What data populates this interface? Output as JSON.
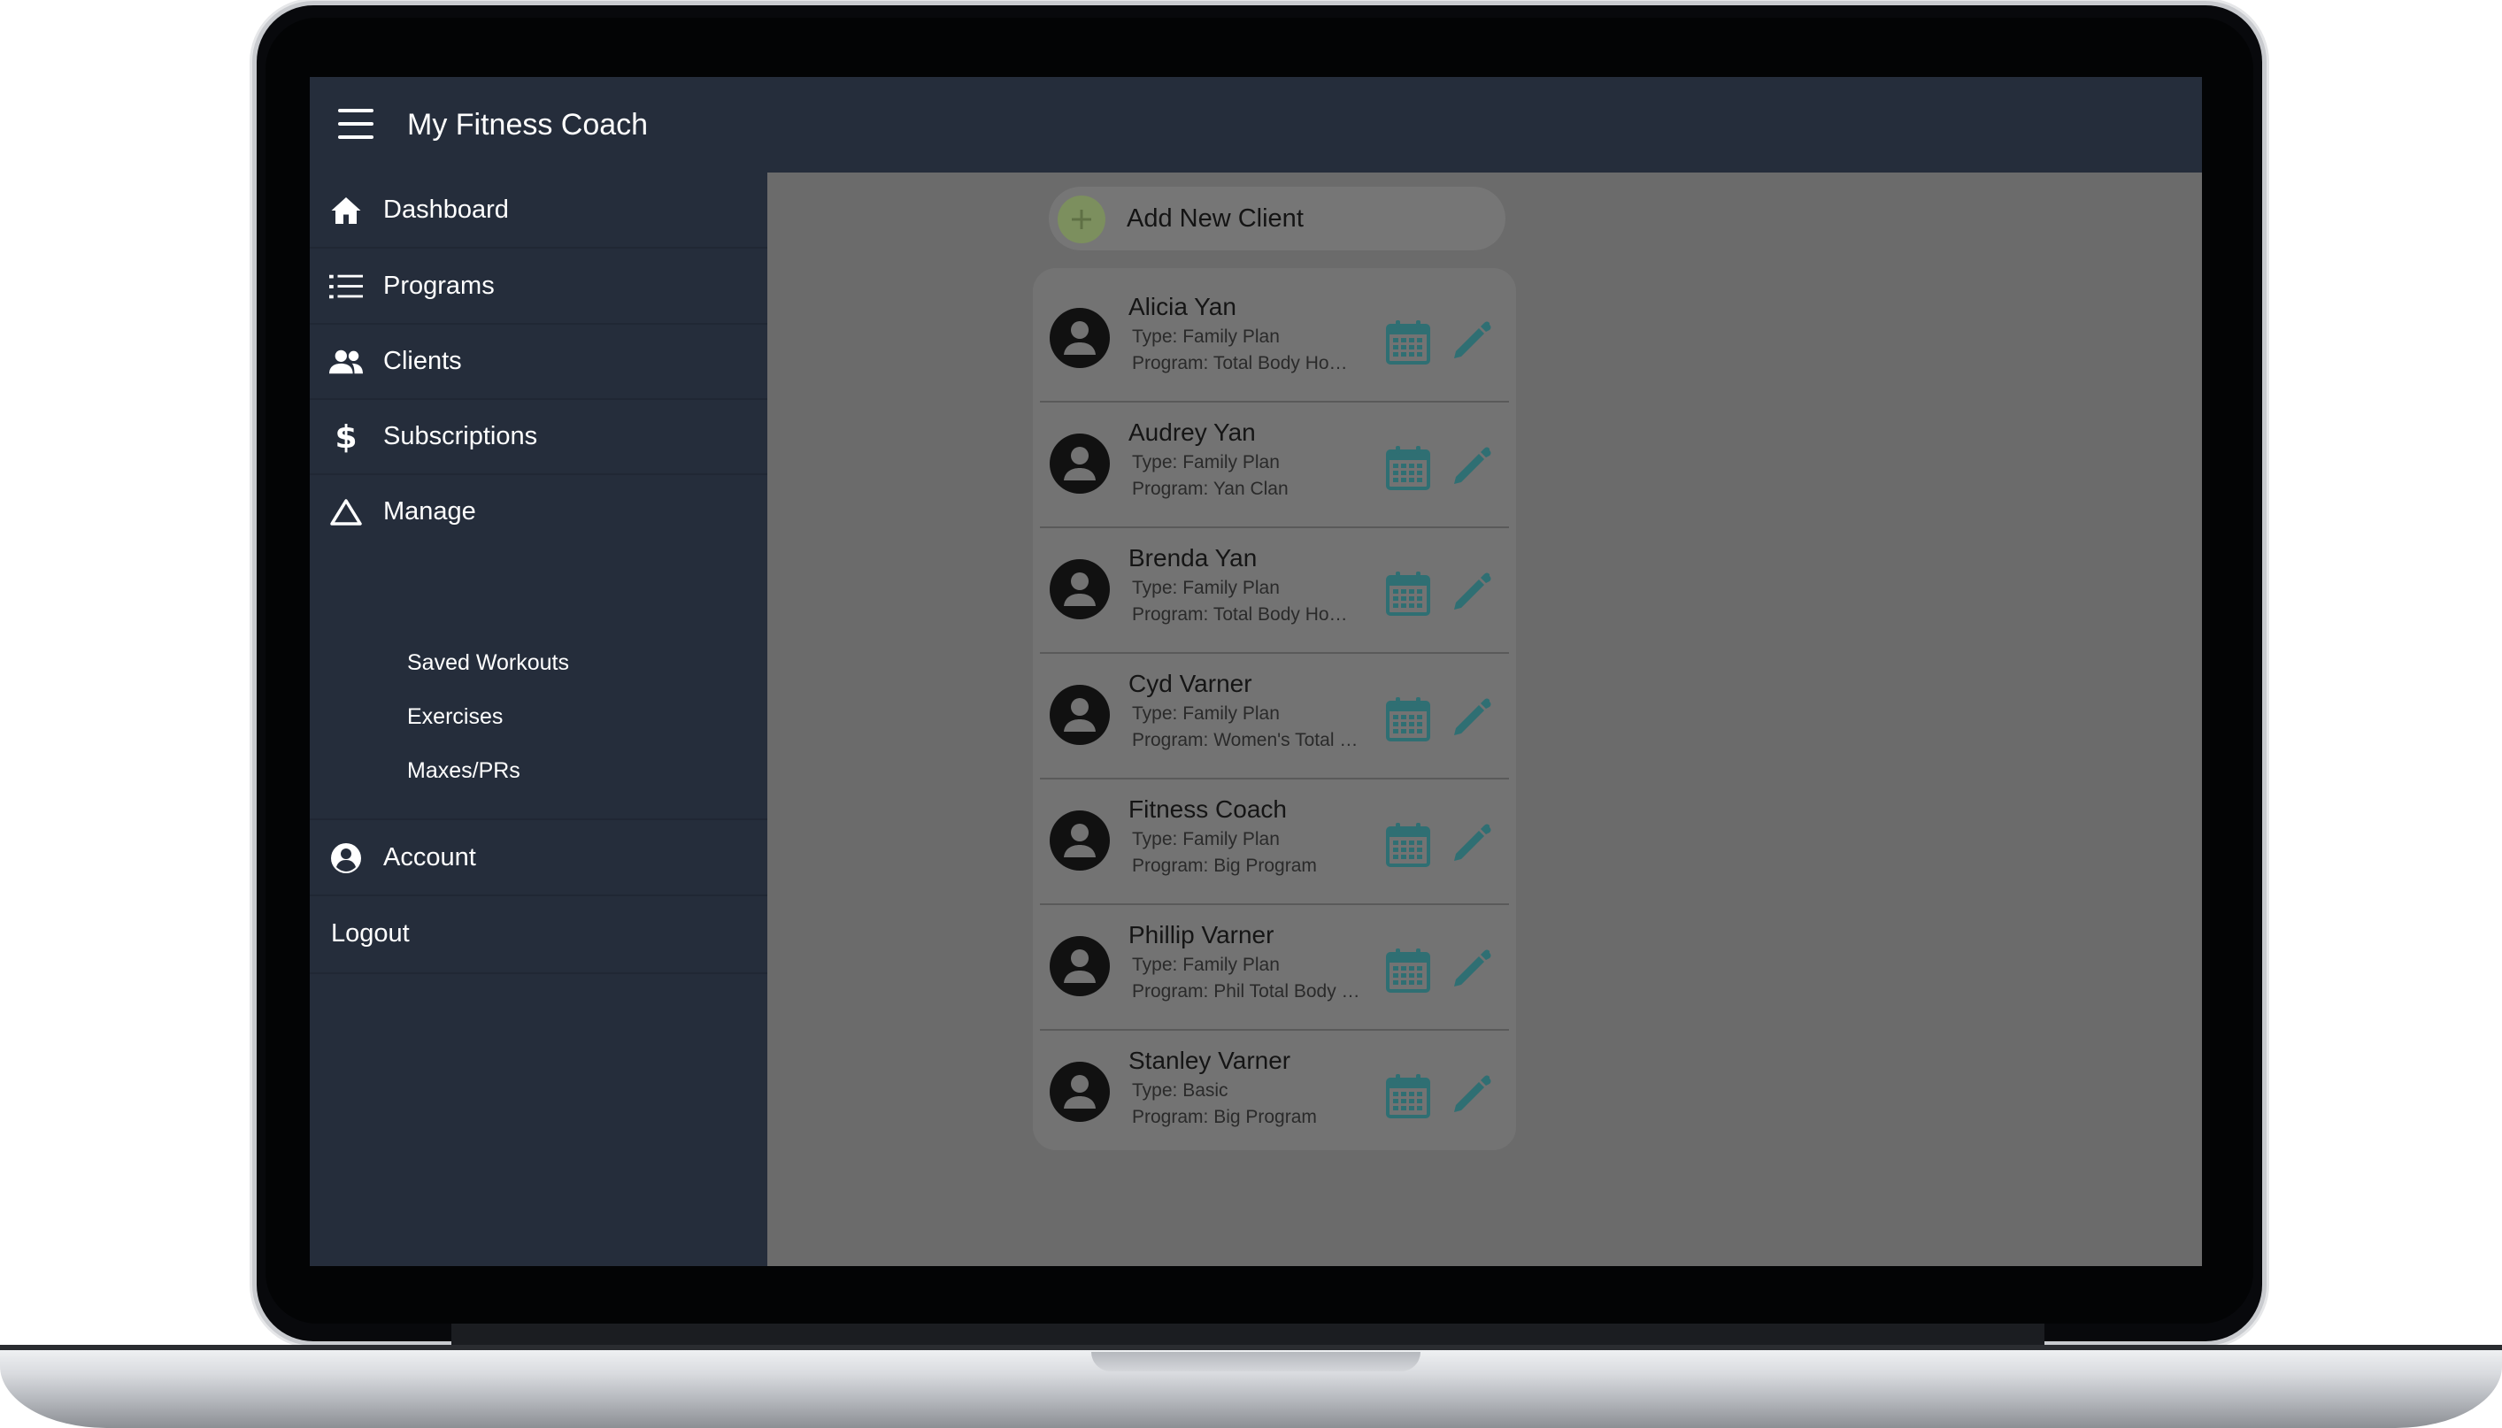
{
  "app": {
    "title": "My Fitness Coach"
  },
  "sidebar": {
    "items": [
      {
        "label": "Dashboard",
        "icon": "home-icon"
      },
      {
        "label": "Programs",
        "icon": "list-icon"
      },
      {
        "label": "Clients",
        "icon": "people-icon"
      },
      {
        "label": "Subscriptions",
        "icon": "dollar-icon"
      },
      {
        "label": "Manage",
        "icon": "triangle-icon"
      }
    ],
    "manage_subitems": [
      "Saved Workouts",
      "Exercises",
      "Maxes/PRs"
    ],
    "account": {
      "label": "Account",
      "icon": "account-circle-icon"
    },
    "logout": "Logout"
  },
  "main": {
    "add_client_label": "Add New Client",
    "clients": [
      {
        "name": "Alicia Yan",
        "type": "Type: Family Plan",
        "program": "Program: Total Body Ho…"
      },
      {
        "name": "Audrey Yan",
        "type": "Type: Family Plan",
        "program": "Program: Yan Clan"
      },
      {
        "name": "Brenda Yan",
        "type": "Type: Family Plan",
        "program": "Program: Total Body Ho…"
      },
      {
        "name": "Cyd Varner",
        "type": "Type: Family Plan",
        "program": "Program: Women's Total …"
      },
      {
        "name": "Fitness Coach",
        "type": "Type: Family Plan",
        "program": "Program: Big Program"
      },
      {
        "name": "Phillip Varner",
        "type": "Type: Family Plan",
        "program": "Program: Phil Total Body …"
      },
      {
        "name": "Stanley Varner",
        "type": "Type: Basic",
        "program": "Program: Big Program"
      }
    ]
  },
  "colors": {
    "sidebar_bg": "#252d3b",
    "overlay_bg": "#6b6b6b",
    "icon_teal": "#2f6f73",
    "add_green": "#7c8f5e"
  }
}
